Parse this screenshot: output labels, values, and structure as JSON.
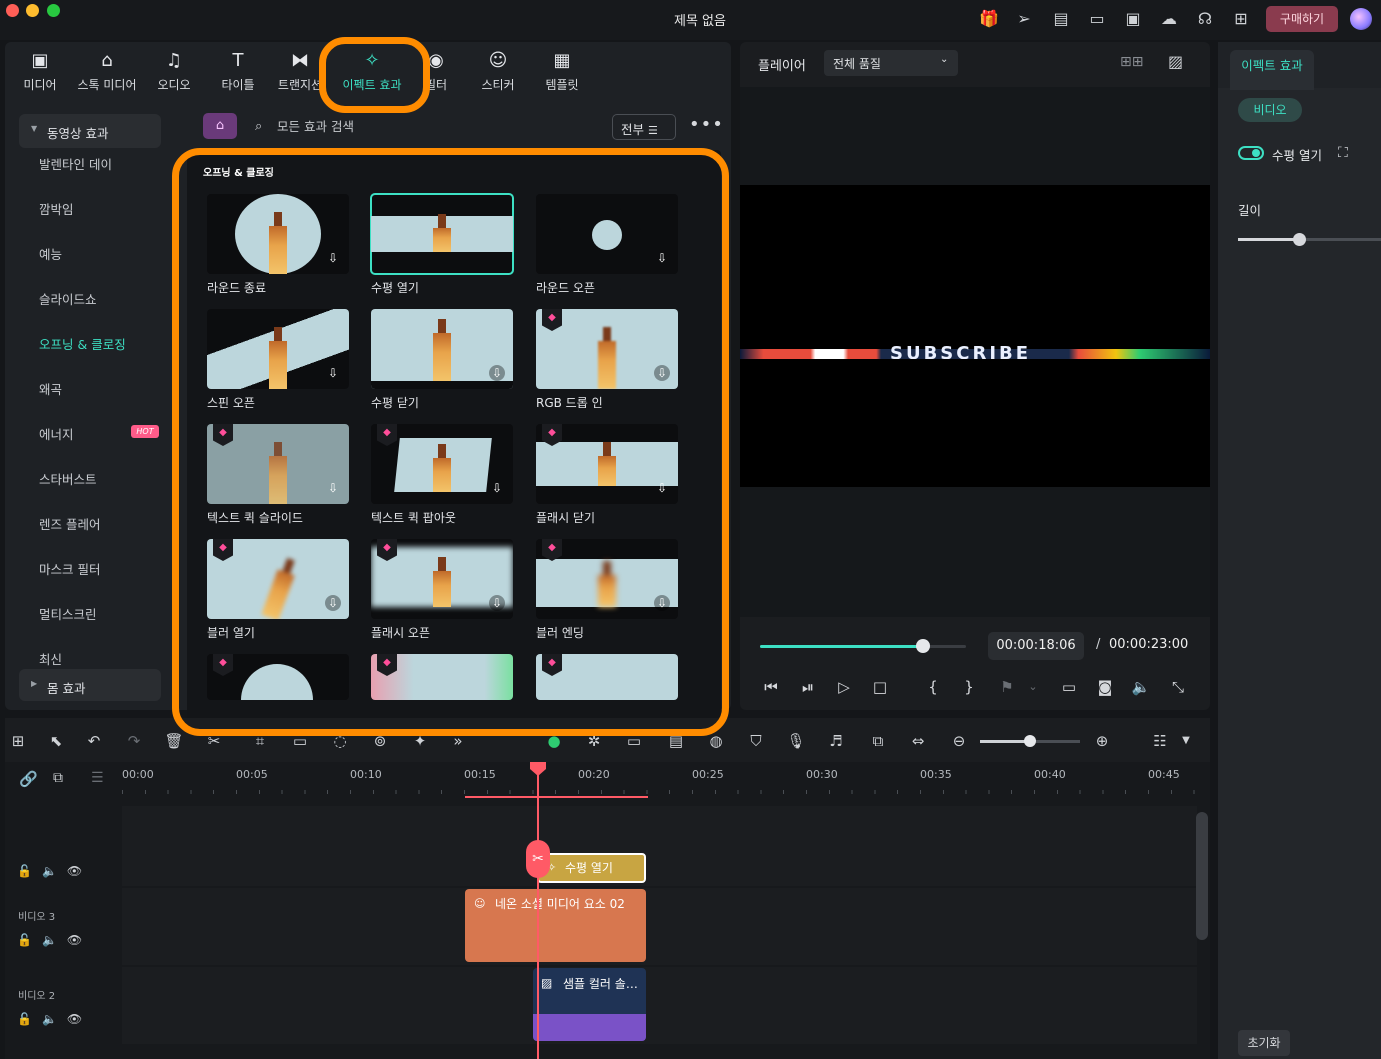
{
  "window": {
    "title": "제목 없음",
    "buy_label": "구매하기"
  },
  "library": {
    "tabs": [
      {
        "label": "미디어",
        "icon": "media-icon"
      },
      {
        "label": "스톡 미디어",
        "icon": "stock-media-icon"
      },
      {
        "label": "오디오",
        "icon": "audio-icon"
      },
      {
        "label": "타이틀",
        "icon": "title-icon"
      },
      {
        "label": "트랜지션",
        "icon": "transition-icon"
      },
      {
        "label": "이펙트 효과",
        "icon": "effects-icon"
      },
      {
        "label": "필터",
        "icon": "filter-icon"
      },
      {
        "label": "스티커",
        "icon": "sticker-icon"
      },
      {
        "label": "템플릿",
        "icon": "template-icon"
      }
    ],
    "sidebar": {
      "group": "동영상 효과",
      "items": [
        "발렌타인 데이",
        "깜박임",
        "예능",
        "슬라이드쇼",
        "오프닝 & 클로징",
        "왜곡",
        "에너지",
        "스타버스트",
        "렌즈 플레어",
        "마스크 필터",
        "멀티스크린",
        "최신"
      ],
      "hot_badge": "HOT",
      "footer_group": "몸 효과"
    },
    "search": {
      "placeholder": "모든 효과 검색"
    },
    "filter_label": "전부",
    "section_title": "오프닝 & 클로징",
    "effects": [
      {
        "label": "라운드 종료",
        "premium": false
      },
      {
        "label": "수평 열기",
        "premium": false
      },
      {
        "label": "라운드 오픈",
        "premium": false
      },
      {
        "label": "스핀 오픈",
        "premium": false
      },
      {
        "label": "수평 닫기",
        "premium": false
      },
      {
        "label": "RGB 드롭 인",
        "premium": true
      },
      {
        "label": "텍스트 퀵 슬라이드",
        "premium": true
      },
      {
        "label": "텍스트 퀵 팝아웃",
        "premium": true
      },
      {
        "label": "플래시 닫기",
        "premium": true
      },
      {
        "label": "블러 열기",
        "premium": true
      },
      {
        "label": "플래시 오픈",
        "premium": true
      },
      {
        "label": "블러 엔딩",
        "premium": true
      }
    ]
  },
  "player": {
    "label": "플레이어",
    "quality": "전체 품질",
    "progress": 0.79,
    "current_time": "00:00:18:06",
    "separator": "/",
    "total_time": "00:00:23:00",
    "frame_text": "SUBSCRIBE"
  },
  "properties": {
    "tab": "이펙트 효과",
    "pill": "비디오",
    "effect_name": "수평 열기",
    "duration_label": "길이",
    "duration_value": 0.43,
    "reset_label": "초기화"
  },
  "timeline": {
    "ruler": [
      "00:00",
      "00:05",
      "00:10",
      "00:15",
      "00:20",
      "00:25",
      "00:30",
      "00:35",
      "00:40",
      "00:45"
    ],
    "zoom": 0.5,
    "tracks": [
      {
        "label": ""
      },
      {
        "label": "비디오 3"
      },
      {
        "label": "비디오 2"
      }
    ],
    "clips": {
      "effect": "수평 열기",
      "social": "네온 소셜 미디어 요소 02",
      "color": "샘플 컬러 솔…"
    }
  }
}
